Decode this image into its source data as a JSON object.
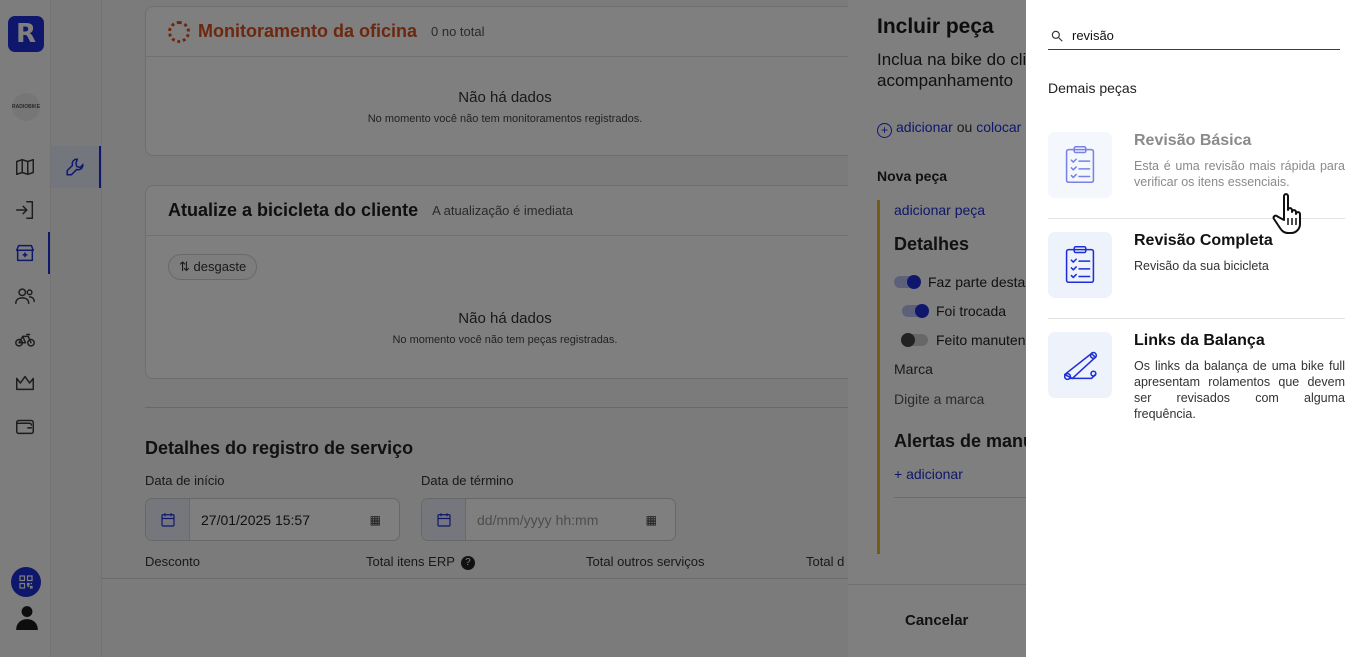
{
  "sidebar": {
    "logo_letter": "R",
    "shop_logo_text": "RADIOBIKE",
    "icons": [
      "map-icon",
      "login-icon",
      "store-icon",
      "users-icon",
      "bike-icon",
      "crown-icon",
      "wallet-icon"
    ],
    "accent": "#1d2fd6"
  },
  "main": {
    "monitoring": {
      "title": "Monitoramento da oficina",
      "count": "0 no total",
      "empty_title": "Não há dados",
      "empty_sub": "No momento você não tem monitoramentos registrados."
    },
    "update_bike": {
      "title": "Atualize a bicicleta do cliente",
      "subtitle": "A atualização é imediata",
      "chip": "⇅ desgaste",
      "empty_title": "Não há dados",
      "empty_sub": "No momento você não tem peças registradas."
    },
    "service": {
      "title": "Detalhes do registro de serviço",
      "start_label": "Data de início",
      "start_value": "27/01/2025 15:57",
      "end_label": "Data de término",
      "end_placeholder": "dd/mm/yyyy hh:mm",
      "discount_label": "Desconto",
      "erp_label": "Total itens ERP",
      "other_label": "Total outros serviços",
      "total_label": "Total d"
    }
  },
  "drawer": {
    "title": "Incluir peça",
    "description": "Inclua na bike do cliente para manter o acompanhamento",
    "link_add": "adicionar",
    "link_or": "ou",
    "link_place": "colocar",
    "new_part": "Nova peça",
    "add_part": "adicionar peça",
    "details": "Detalhes",
    "toggles": [
      {
        "label": "Faz parte desta bike",
        "on": true
      },
      {
        "label": "Foi trocada",
        "on": true
      },
      {
        "label": "Feito manutenção",
        "on": false
      }
    ],
    "brand_label": "Marca",
    "brand_placeholder": "Digite a marca",
    "alerts_title": "Alertas de manutenção",
    "alerts_add": "+ adicionar",
    "cancel": "Cancelar"
  },
  "panel": {
    "search_value": "revisão",
    "group_title": "Demais peças",
    "items": [
      {
        "name": "Revisão Básica",
        "desc": "Esta é uma revisão mais rápida para verificar os itens essenciais.",
        "icon": "clipboard-icon"
      },
      {
        "name": "Revisão Completa",
        "desc": "Revisão da sua bicicleta",
        "icon": "clipboard-icon"
      },
      {
        "name": "Links da Balança",
        "desc": "Os links da balança de uma bike full apresentam rolamentos que devem ser revisados com alguma frequência.",
        "icon": "link-arm-icon"
      }
    ]
  }
}
